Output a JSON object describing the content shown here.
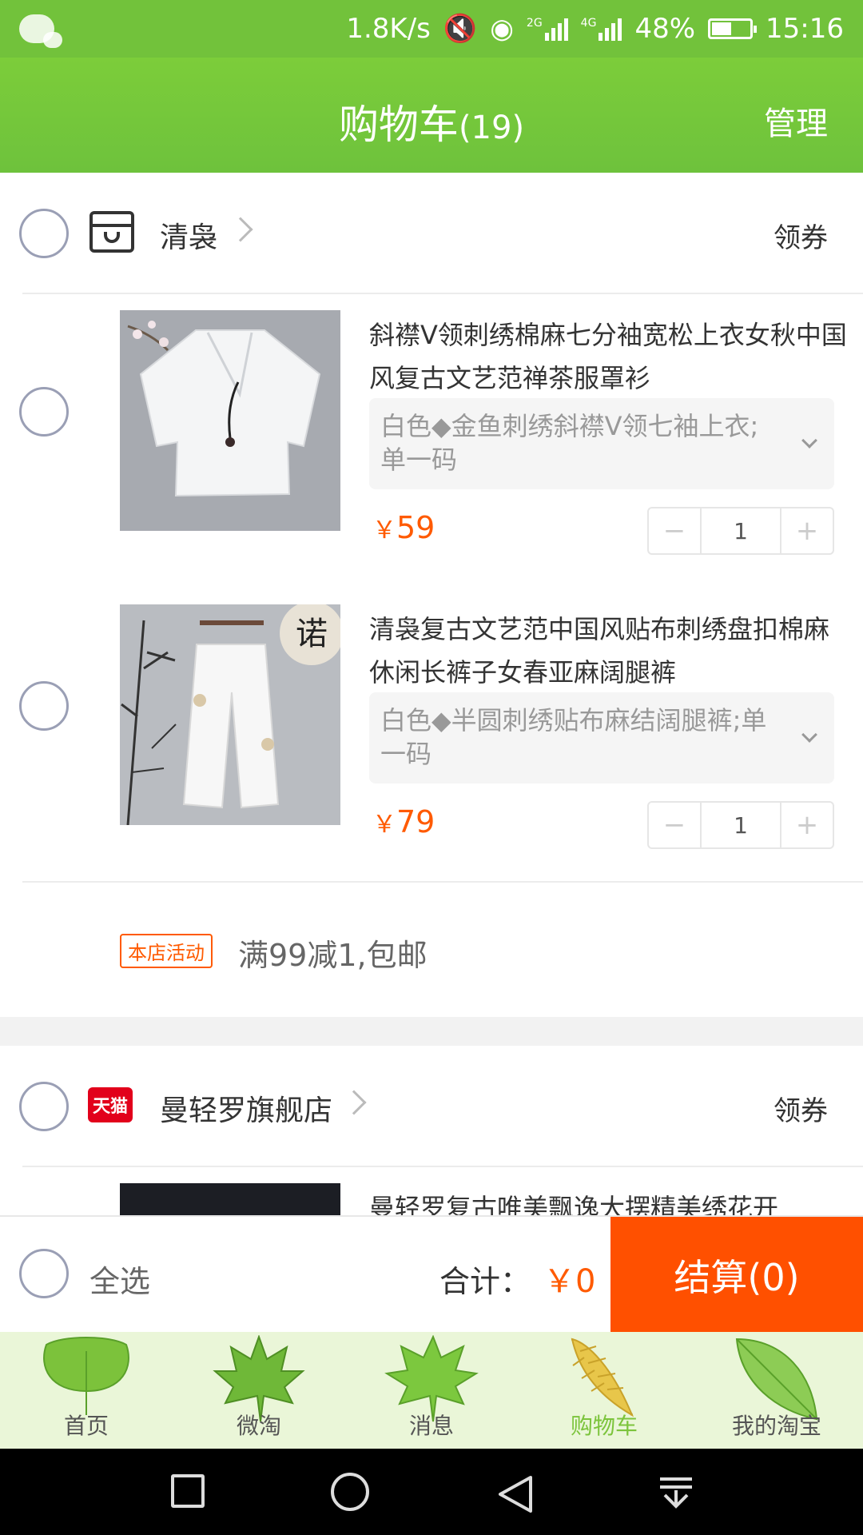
{
  "status_bar": {
    "speed": "1.8K/s",
    "net2": "2G",
    "net4": "4G",
    "battery": "48%",
    "time": "15:16"
  },
  "header": {
    "title": "购物车",
    "count": "(19)",
    "manage": "管理"
  },
  "shops": [
    {
      "name": "清袅",
      "coupon": "领券",
      "items": [
        {
          "title": "斜襟V领刺绣棉麻七分袖宽松上衣女秋中国风复古文艺范禅茶服罩衫",
          "sku": "白色◆金鱼刺绣斜襟V领七袖上衣;单一码",
          "currency": "￥",
          "price": "59",
          "qty": "1"
        },
        {
          "title": "清袅复古文艺范中国风贴布刺绣盘扣棉麻休闲长裤子女春亚麻阔腿裤",
          "sku": "白色◆半圆刺绣贴布麻结阔腿裤;单一码",
          "currency": "￥",
          "price": "79",
          "qty": "1"
        }
      ],
      "promo_tag": "本店活动",
      "promo_text": "满99减1,包邮"
    },
    {
      "name": "曼轻罗旗舰店",
      "badge": "天猫",
      "coupon": "领券",
      "items": [
        {
          "title": "曼轻罗复古唯美飘逸大摆精美绣花开"
        }
      ]
    }
  ],
  "checkout": {
    "select_all": "全选",
    "total_label": "合计：",
    "total_value": "￥0",
    "button": "结算(0)"
  },
  "tabs": [
    {
      "label": "首页",
      "icon": "ginkgo-leaf-icon"
    },
    {
      "label": "微淘",
      "icon": "maple-leaf-icon"
    },
    {
      "label": "消息",
      "icon": "maple-leaf-icon"
    },
    {
      "label": "购物车",
      "icon": "palm-leaf-icon",
      "active": true
    },
    {
      "label": "我的淘宝",
      "icon": "oval-leaf-icon"
    }
  ],
  "colors": {
    "brand_green": "#72c23b",
    "accent_orange": "#ff5000",
    "price_orange": "#ff5a00",
    "tmall_red": "#e2001b"
  }
}
